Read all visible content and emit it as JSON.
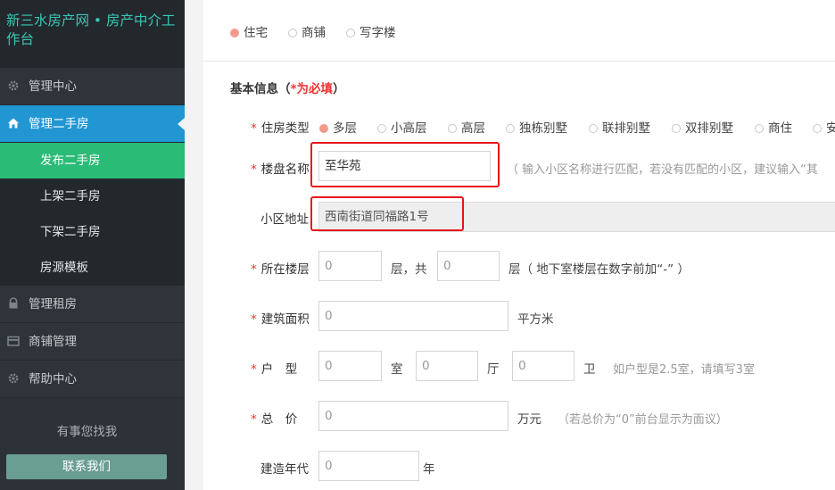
{
  "sidebar": {
    "brand": "新三水房产网 • 房产中介工作台",
    "nav": [
      {
        "label": "管理中心",
        "icon": "gear-icon"
      },
      {
        "label": "管理二手房",
        "icon": "house-icon"
      }
    ],
    "sub_items": [
      "发布二手房",
      "上架二手房",
      "下架二手房",
      "房源模板"
    ],
    "nav_bottom": [
      {
        "label": "管理租房",
        "icon": "lock-icon"
      },
      {
        "label": "商铺管理",
        "icon": "card-icon"
      },
      {
        "label": "帮助中心",
        "icon": "gear-icon"
      }
    ],
    "help_text": "有事您找我",
    "contact_label": "联系我们"
  },
  "property_category": {
    "options": [
      "住宅",
      "商铺",
      "写字楼"
    ],
    "selected": "住宅"
  },
  "section": {
    "title_prefix": "基本信息（",
    "title_required": "*为必填",
    "title_suffix": "）"
  },
  "form": {
    "star": "*",
    "house_type": {
      "label": "住房类型",
      "options": [
        "多层",
        "小高层",
        "高层",
        "独栋别墅",
        "联排别墅",
        "双排别墅",
        "商住",
        "安"
      ],
      "selected": "多层"
    },
    "estate_name": {
      "label": "楼盘名称",
      "value": "至华苑",
      "hint": "（ 输入小区名称进行匹配，若没有匹配的小区，建议输入“其"
    },
    "address": {
      "label": "小区地址",
      "value": "西南街道同福路1号"
    },
    "floor": {
      "label": "所在楼层",
      "floor_placeholder": "0",
      "unit_mid": "层，共",
      "total_placeholder": "0",
      "unit_end": "层（ 地下室楼层在数字前加“-” ）"
    },
    "area": {
      "label": "建筑面积",
      "placeholder": "0",
      "unit": "平方米"
    },
    "layout": {
      "label": "户　型",
      "room_placeholder": "0",
      "room_unit": "室",
      "hall_placeholder": "0",
      "hall_unit": "厅",
      "bath_placeholder": "0",
      "bath_unit": "卫",
      "hint": "如户型是2.5室，请填写3室"
    },
    "price": {
      "label": "总　价",
      "placeholder": "0",
      "unit": "万元",
      "hint": "（若总价为“0”前台显示为面议）"
    },
    "year": {
      "label": "建造年代",
      "placeholder": "0",
      "unit": "年"
    }
  },
  "colors": {
    "sidebar_bg": "#2d3238",
    "brand_text": "#39c7b5",
    "active_nav": "#2196d3",
    "active_sub": "#2abb76",
    "contact_button": "#6b9e93",
    "required_star": "#e33333",
    "highlight_box": "#e8141b",
    "radio_selected": "#f29b8c"
  }
}
